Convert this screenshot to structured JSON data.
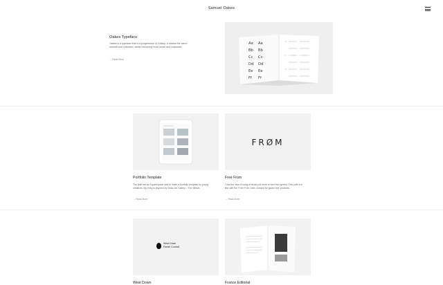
{
  "site": {
    "title": "Samuel Oakes"
  },
  "feature": {
    "title": "Oakes Typeface",
    "description": "Oakes is a typeface that is a progression of Octavy. It retains the same warmth and character, whilst becoming more smart and corporate.",
    "read_more": "→ Read More"
  },
  "projects": [
    {
      "title": "Portfolio Template",
      "description": "The brief set by Squarespace was to make a portfolio template for young creatives. My entry is inspired by Swiss Art Gallery – The Wilson.",
      "read_more": "→ Read More"
    },
    {
      "title": "Free From",
      "logo_text": "FRØM",
      "description": "I had the idea of using a struck-out circle to form the symbol. This pulls it in line with the 'Free From' brief. A brand for gluten free products.",
      "read_more": "→ Read More"
    },
    {
      "title": "West Down",
      "logo_line1": "West Down",
      "logo_line2": "Parish Council"
    },
    {
      "title": "France Editorial"
    }
  ],
  "colors": {
    "background": "#ffffff",
    "thumb": "#f2f2f2",
    "text": "#222222",
    "muted": "#666666"
  },
  "icons": {
    "menu": "hamburger-icon"
  }
}
